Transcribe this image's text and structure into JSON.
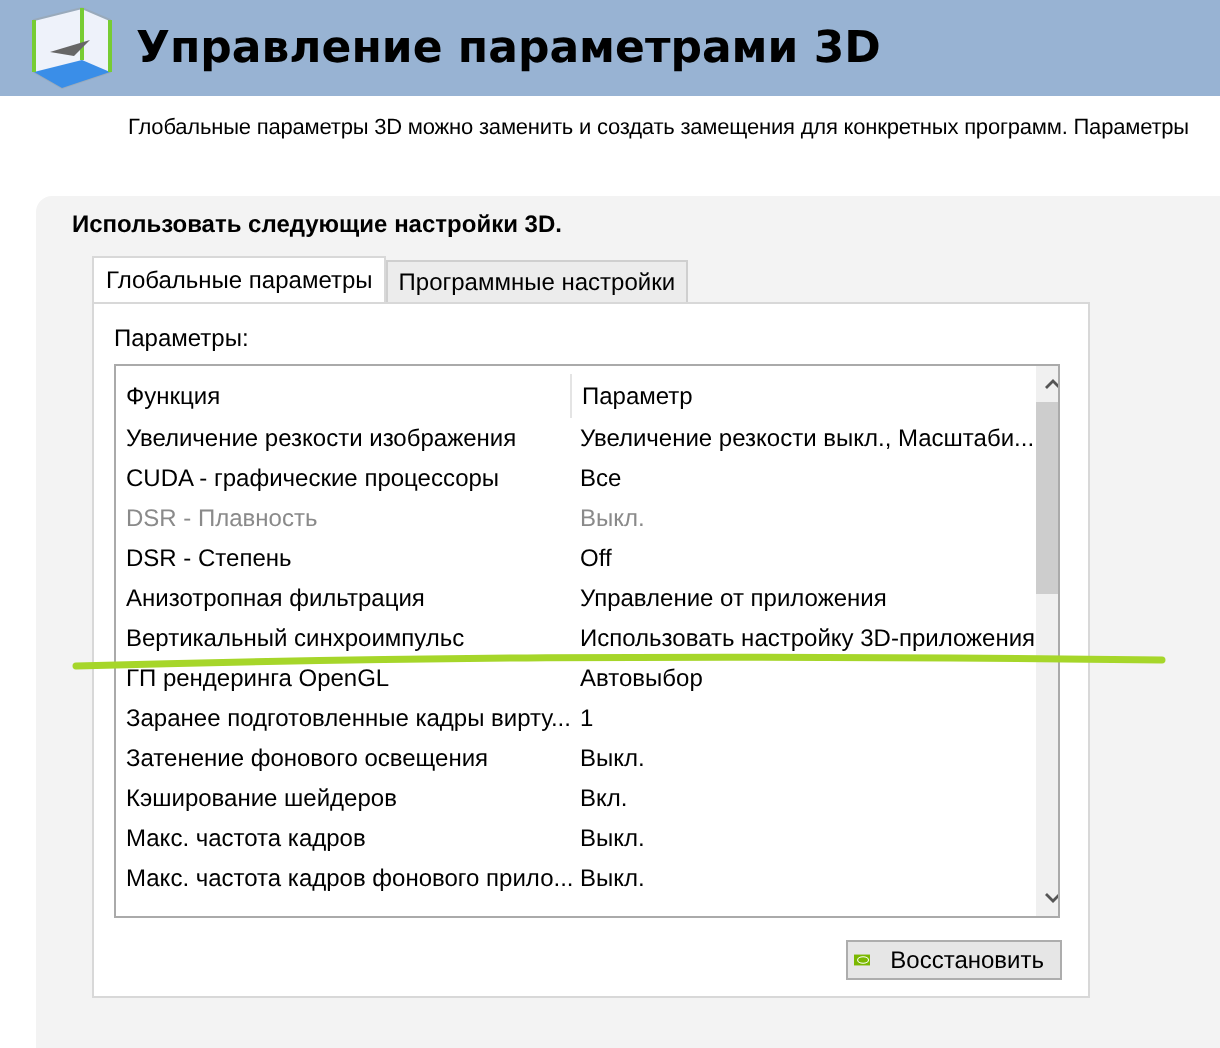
{
  "header": {
    "title": "Управление параметрами 3D"
  },
  "description": "Глобальные параметры 3D можно заменить и создать замещения для конкретных программ. Параметры",
  "panel": {
    "heading": "Использовать следующие настройки 3D.",
    "tabs": [
      {
        "label": "Глобальные параметры",
        "selected": true
      },
      {
        "label": "Программные настройки",
        "selected": false
      }
    ],
    "list_label": "Параметры:",
    "columns": [
      "Функция",
      "Параметр"
    ],
    "rows": [
      {
        "feature": "Увеличение резкости изображения",
        "value": "Увеличение резкости выкл., Масштаби...",
        "disabled": false
      },
      {
        "feature": "CUDA - графические процессоры",
        "value": "Все",
        "disabled": false
      },
      {
        "feature": "DSR - Плавность",
        "value": "Выкл.",
        "disabled": true
      },
      {
        "feature": "DSR - Степень",
        "value": "Off",
        "disabled": false
      },
      {
        "feature": "Анизотропная фильтрация",
        "value": "Управление от приложения",
        "disabled": false
      },
      {
        "feature": "Вертикальный синхроимпульс",
        "value": "Использовать настройку 3D-приложения",
        "disabled": false
      },
      {
        "feature": "ГП рендеринга OpenGL",
        "value": "Автовыбор",
        "disabled": false
      },
      {
        "feature": "Заранее подготовленные кадры вирту...",
        "value": "1",
        "disabled": false
      },
      {
        "feature": "Затенение фонового освещения",
        "value": "Выкл.",
        "disabled": false
      },
      {
        "feature": "Кэширование шейдеров",
        "value": "Вкл.",
        "disabled": false
      },
      {
        "feature": "Макс. частота кадров",
        "value": "Выкл.",
        "disabled": false
      },
      {
        "feature": "Макс. частота кадров фонового прило...",
        "value": "Выкл.",
        "disabled": false
      }
    ],
    "restore_button": "Восстановить"
  }
}
